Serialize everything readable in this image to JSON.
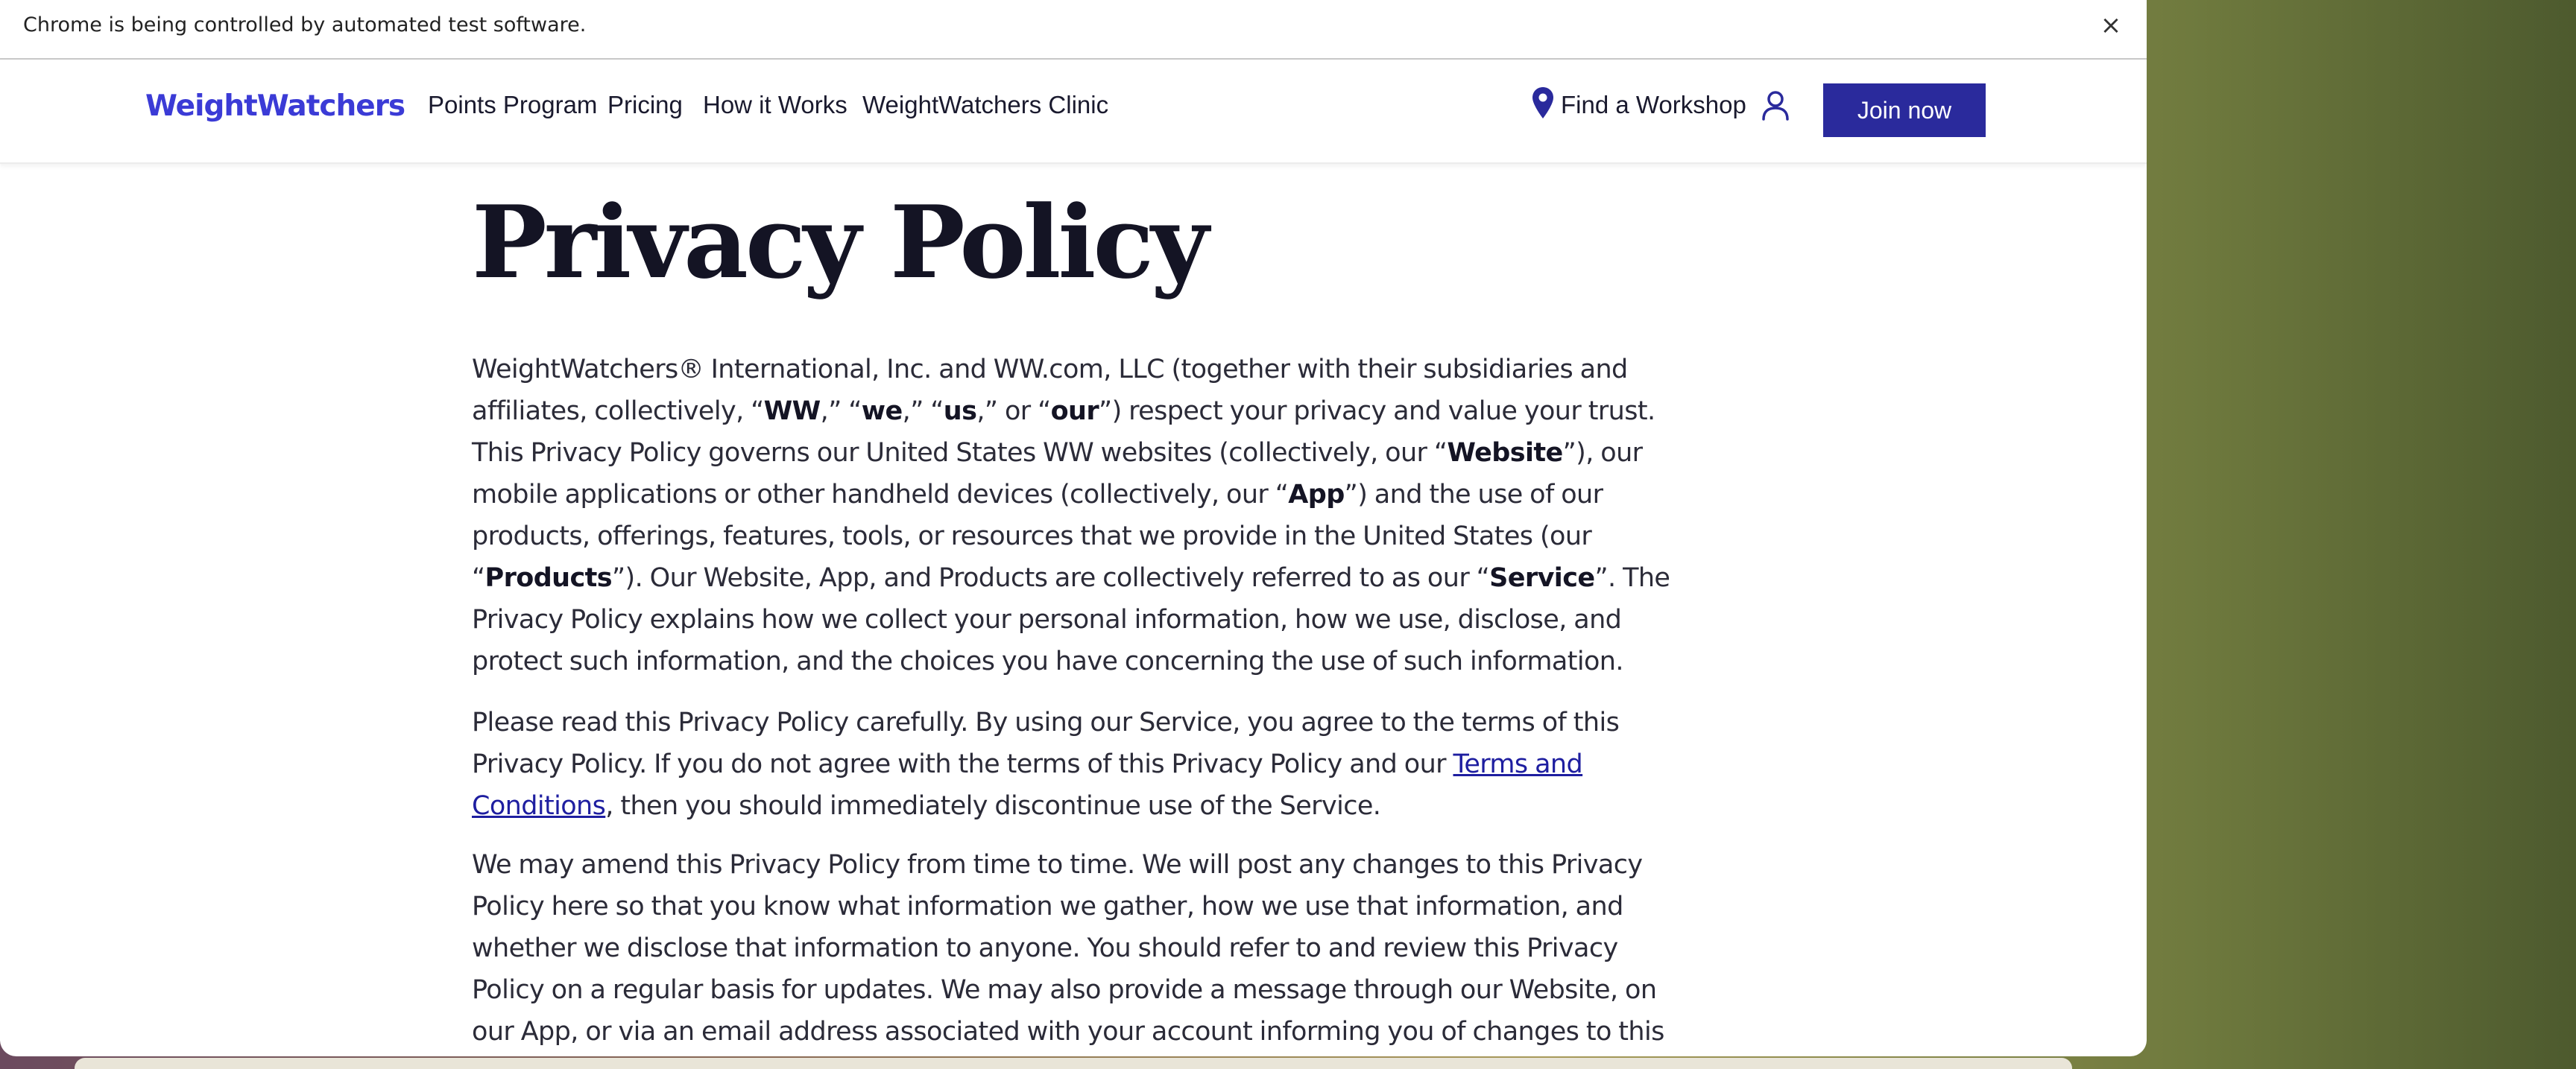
{
  "infobar": {
    "message": "Chrome is being controlled by automated test software.",
    "close": "×"
  },
  "header": {
    "logo": "WeightWatchers",
    "nav": {
      "points": "Points Program",
      "pricing": "Pricing",
      "how": "How it Works",
      "clinic": "WeightWatchers Clinic"
    },
    "find_workshop": "Find a Workshop",
    "join": "Join now",
    "icons": {
      "location": "map-pin-icon",
      "account": "user-icon"
    }
  },
  "main": {
    "title": "Privacy Policy",
    "p1": {
      "t1": "WeightWatchers® International, Inc. and WW.com, LLC (together with their subsidiaries and affiliates, collectively, “",
      "b1": "WW",
      "t2": ",” “",
      "b2": "we",
      "t3": ",” “",
      "b3": "us",
      "t4": ",” or “",
      "b4": "our",
      "t5": "”) respect your privacy and value your trust. This Privacy Policy governs our United States WW websites (collectively, our “",
      "b5": "Website",
      "t6": "”), our mobile applications or other handheld devices (collectively, our “",
      "b6": "App",
      "t7": "”) and the use of our products, offerings, features, tools, or resources that we provide in the United States (our “",
      "b7": "Products",
      "t8": "”). Our Website, App, and Products are collectively referred to as our “",
      "b8": "Service",
      "t9": "”. The Privacy Policy explains how we collect your personal information, how we use, disclose, and protect such information, and the choices you have concerning the use of such information."
    },
    "p2": {
      "t1": "Please read this Privacy Policy carefully. By using our Service, you agree to the terms of this Privacy Policy. If you do not agree with the terms of this Privacy Policy and our ",
      "link": "Terms and Conditions",
      "t2": ", then you should immediately discontinue use of the Service."
    },
    "p3": "We may amend this Privacy Policy from time to time. We will post any changes to this Privacy Policy here so that you know what information we gather, how we use that information, and whether we disclose that information to anyone. You should refer to and review this Privacy Policy on a regular basis for updates. We may also provide a message through our Website, on our App, or via an email address associated with your account informing you of changes to this Privacy Policy."
  },
  "colors": {
    "brand": "#3b3bd6",
    "button": "#2a2a9c",
    "link": "#1e1ea0",
    "text": "#2b2b38"
  }
}
